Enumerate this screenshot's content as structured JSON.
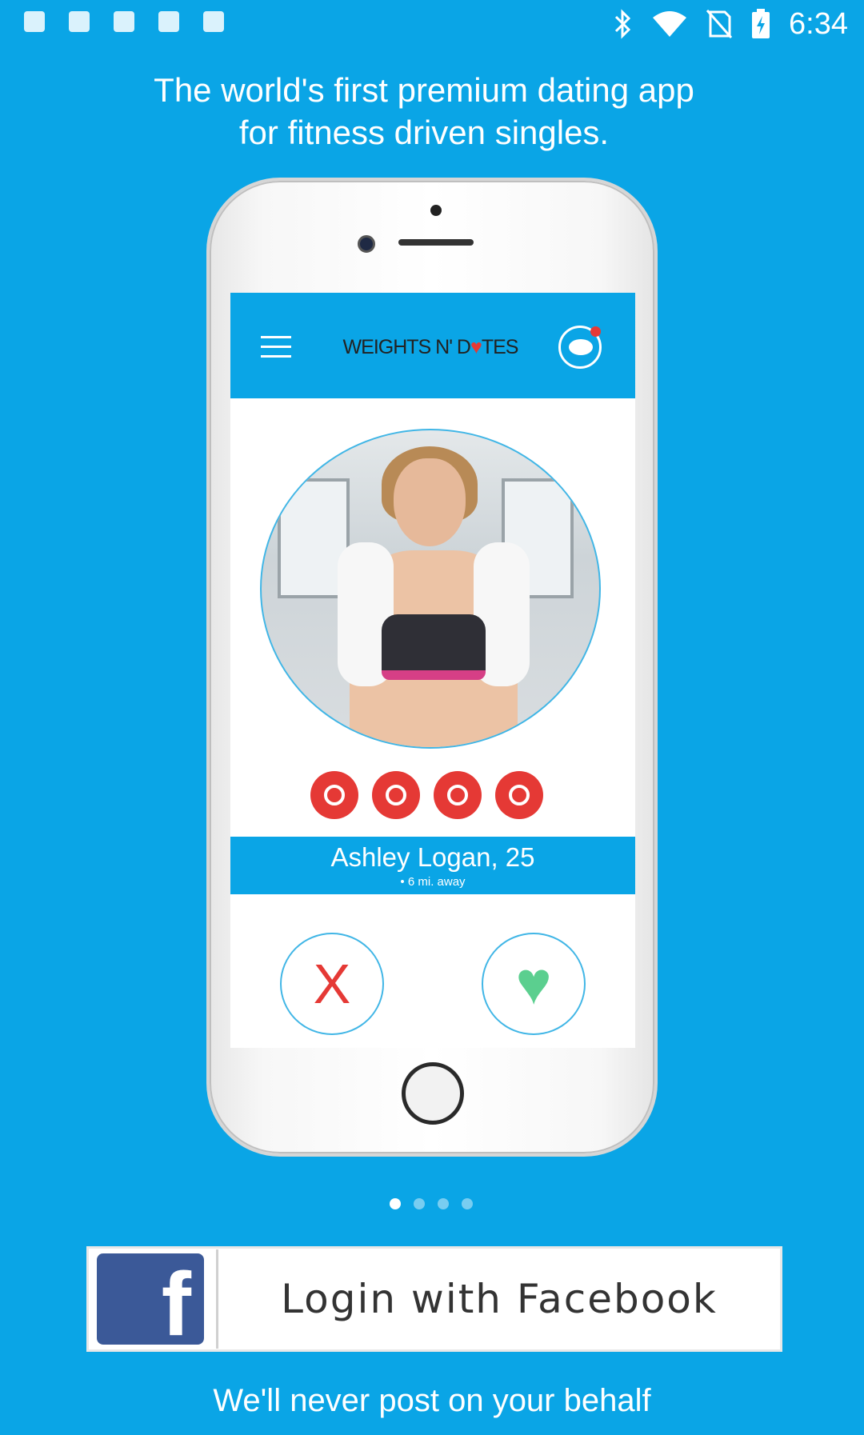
{
  "status_bar": {
    "time": "6:34",
    "icons_left": [
      "notification-icon",
      "photo-icon",
      "sync-icon",
      "download-icon",
      "lock-icon"
    ],
    "icons_right": [
      "bluetooth-icon",
      "wifi-icon",
      "no-sim-icon",
      "battery-charging-icon"
    ]
  },
  "headline": "The world's first premium dating app for fitness driven singles.",
  "mockup": {
    "brand": {
      "part1": "WEIGHTS N' D",
      "part2": "TES"
    },
    "profile": {
      "name": "Ashley Logan, 25",
      "distance": "6 mi. away"
    },
    "interests": [
      "heart-icon",
      "kettlebell-icon",
      "flexed-arm-icon",
      "yin-yang-icon"
    ],
    "reject_glyph": "X",
    "like_glyph": "♥"
  },
  "page_indicator": {
    "pages": 4,
    "active": 1
  },
  "facebook_button": {
    "label": "Login with Facebook",
    "logo_letter": "f"
  },
  "footnote": "We'll never post on your behalf",
  "colors": {
    "background": "#0aa5e6",
    "facebook": "#3b5998",
    "accent_red": "#e53935",
    "like_green": "#5bcf8f"
  }
}
